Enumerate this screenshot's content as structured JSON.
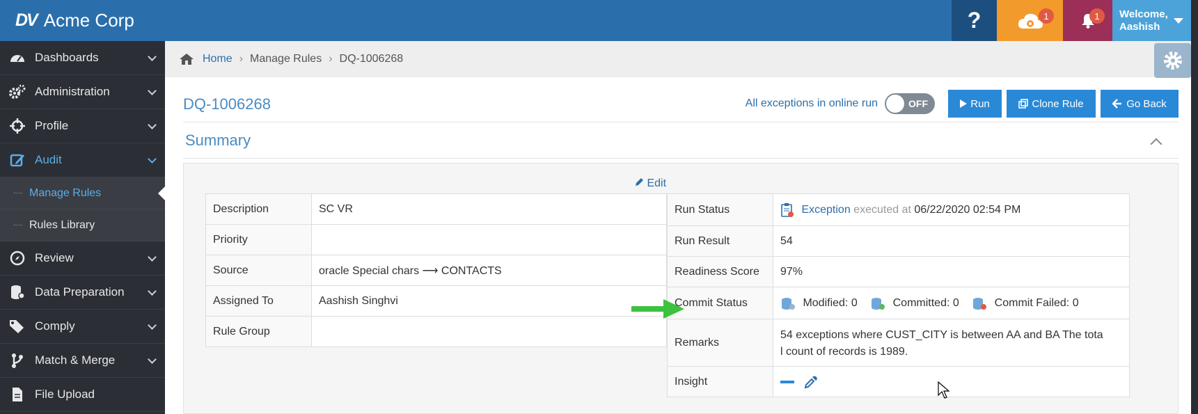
{
  "app": {
    "brand_logo": "DV",
    "brand_name": "Acme Corp"
  },
  "topbar": {
    "help_label": "?",
    "cloud_badge": "1",
    "bell_badge": "1",
    "welcome": "Welcome,",
    "user": "Aashish"
  },
  "sidebar": {
    "items": [
      {
        "label": "Dashboards",
        "icon": "dashboard-icon"
      },
      {
        "label": "Administration",
        "icon": "cogs-icon"
      },
      {
        "label": "Profile",
        "icon": "crosshair-icon"
      },
      {
        "label": "Audit",
        "icon": "edit-icon"
      },
      {
        "label": "Review",
        "icon": "compass-icon"
      },
      {
        "label": "Data Preparation",
        "icon": "database-icon"
      },
      {
        "label": "Comply",
        "icon": "tags-icon"
      },
      {
        "label": "Match & Merge",
        "icon": "branch-icon"
      },
      {
        "label": "File Upload",
        "icon": "file-icon"
      }
    ],
    "audit_sub": [
      "Manage Rules",
      "Rules Library"
    ]
  },
  "breadcrumb": {
    "home": "Home",
    "level2": "Manage Rules",
    "current": "DQ-1006268"
  },
  "page": {
    "title": "DQ-1006268",
    "toggle_label": "All exceptions in online run",
    "toggle_state": "OFF",
    "run_label": "Run",
    "clone_label": "Clone Rule",
    "back_label": "Go Back",
    "summary_title": "Summary",
    "edit_label": "Edit"
  },
  "details": {
    "rows": [
      {
        "label": "Description",
        "value": "SC VR"
      },
      {
        "label": "Priority",
        "value": ""
      },
      {
        "label": "Source",
        "value": "oracle Special chars ⟶ CONTACTS"
      },
      {
        "label": "Assigned To",
        "value": "Aashish Singhvi"
      },
      {
        "label": "Rule Group",
        "value": ""
      }
    ]
  },
  "status": {
    "run_status_label": "Run Status",
    "run_status_value": "Exception",
    "executed_at_label": "executed at",
    "executed_at_value": "06/22/2020 02:54 PM",
    "run_result_label": "Run Result",
    "run_result_value": "54",
    "readiness_label": "Readiness Score",
    "readiness_value": "97%",
    "commit_label": "Commit Status",
    "modified": "Modified: 0",
    "committed": "Committed: 0",
    "commit_failed": "Commit Failed: 0",
    "remarks_label": "Remarks",
    "remarks_line1": "54 exceptions where CUST_CITY is between AA and BA The tota",
    "remarks_line2": "l count of records is 1989.",
    "insight_label": "Insight"
  },
  "colors": {
    "accent": "#2a89d6",
    "topbar": "#2a6fab",
    "cloud": "#f39a2c",
    "bell": "#9b2f57",
    "arrow": "#3cc23c"
  }
}
